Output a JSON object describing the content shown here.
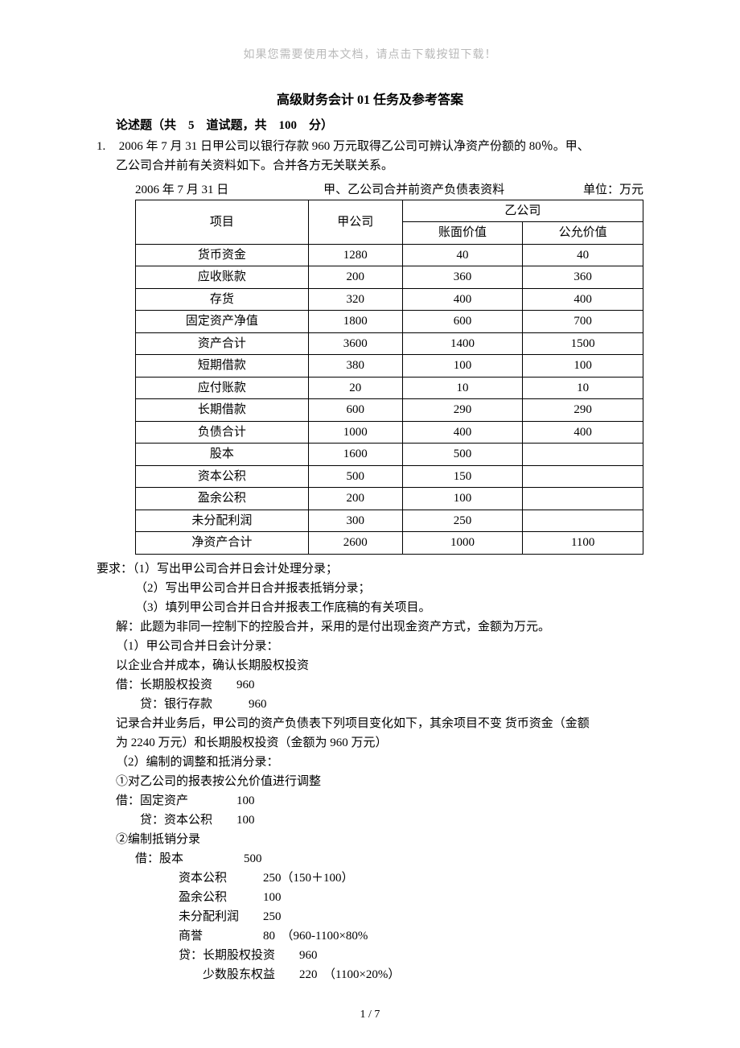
{
  "hint": "如果您需要使用本文档，请点击下载按钮下载！",
  "title": "高级财务会计 01 任务及参考答案",
  "section_head": "论述题（共　5　道试题，共　100　分）",
  "q1_num": "1.",
  "q1_p1": "2006 年 7 月 31 日甲公司以银行存款 960 万元取得乙公司可辨认净资产份额的 80％。甲、",
  "q1_p2": "乙公司合并前有关资料如下。合并各方无关联关系。",
  "table_caption": {
    "date": "2006 年 7 月 31 日",
    "mid": "甲、乙公司合并前资产负债表资料",
    "unit": "单位：万元"
  },
  "table": {
    "head": {
      "c1": "项目",
      "c2": "甲公司",
      "c3": "乙公司",
      "c3a": "账面价值",
      "c3b": "公允价值"
    },
    "rows": [
      {
        "c1": "货币资金",
        "c2": "1280",
        "c3a": "40",
        "c3b": "40"
      },
      {
        "c1": "应收账款",
        "c2": "200",
        "c3a": "360",
        "c3b": "360"
      },
      {
        "c1": "存货",
        "c2": "320",
        "c3a": "400",
        "c3b": "400"
      },
      {
        "c1": "固定资产净值",
        "c2": "1800",
        "c3a": "600",
        "c3b": "700"
      },
      {
        "c1": "资产合计",
        "c2": "3600",
        "c3a": "1400",
        "c3b": "1500"
      },
      {
        "c1": "短期借款",
        "c2": "380",
        "c3a": "100",
        "c3b": "100"
      },
      {
        "c1": "应付账款",
        "c2": "20",
        "c3a": "10",
        "c3b": "10"
      },
      {
        "c1": "长期借款",
        "c2": "600",
        "c3a": "290",
        "c3b": "290"
      },
      {
        "c1": "负债合计",
        "c2": "1000",
        "c3a": "400",
        "c3b": "400"
      },
      {
        "c1": "股本",
        "c2": "1600",
        "c3a": "500",
        "c3b": ""
      },
      {
        "c1": "资本公积",
        "c2": "500",
        "c3a": "150",
        "c3b": ""
      },
      {
        "c1": "盈余公积",
        "c2": "200",
        "c3a": "100",
        "c3b": ""
      },
      {
        "c1": "未分配利润",
        "c2": "300",
        "c3a": "250",
        "c3b": ""
      },
      {
        "c1": "净资产合计",
        "c2": "2600",
        "c3a": "1000",
        "c3b": "1100"
      }
    ]
  },
  "req_label": "要求：",
  "req1": "（1）写出甲公司合并日会计处理分录；",
  "req2": "（2）写出甲公司合并日合并报表抵销分录；",
  "req3": "（3）填列甲公司合并日合并报表工作底稿的有关项目。",
  "ans": {
    "l1": "解：此题为非同一控制下的控股合并，采用的是付出现金资产方式，金额为万元。",
    "l2": "（1）甲公司合并日会计分录：",
    "l3": "以企业合并成本，确认长期股权投资",
    "l4": "借：长期股权投资　　960",
    "l5": "　　贷：银行存款　　　960",
    "l6": "记录合并业务后，甲公司的资产负债表下列项目变化如下，其余项目不变  货币资金（金额",
    "l6b": "为 2240 万元）和长期股权投资（金额为 960 万元）",
    "l7": "（2）编制的调整和抵消分录：",
    "l8": "①对乙公司的报表按公允价值进行调整",
    "l9": "借：固定资产　　　　100",
    "l10": "　　贷：资本公积　　100",
    "l11": "②编制抵销分录",
    "l12": "借：股本　　　　　500",
    "l13": "　　资本公积　　　250（150＋100）",
    "l14": "　　盈余公积　　　100",
    "l15": "　　未分配利润　　250",
    "l16": "　　商誉　　　　　80　（960-1100×80%",
    "l17": "　　贷：长期股权投资　　960",
    "l18": "　　　　少数股东权益　　220　（1100×20%）"
  },
  "page_num": "1 / 7"
}
